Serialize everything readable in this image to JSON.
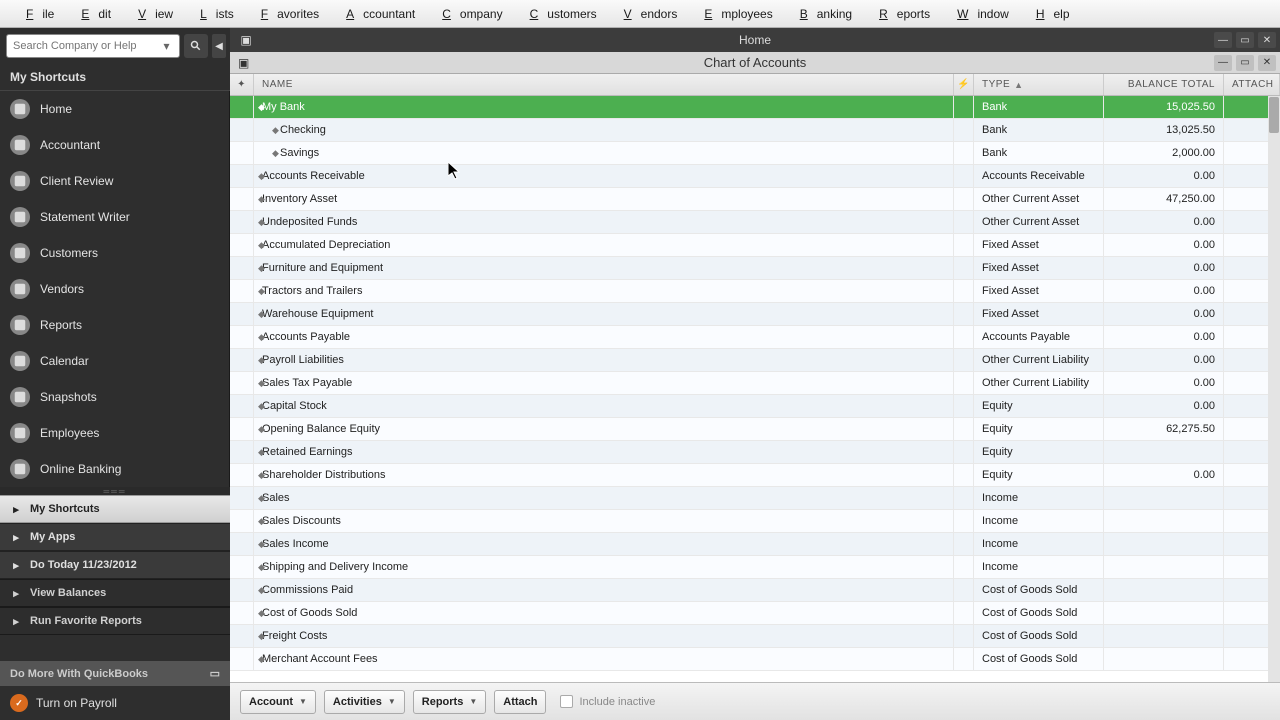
{
  "menubar": [
    "File",
    "Edit",
    "View",
    "Lists",
    "Favorites",
    "Accountant",
    "Company",
    "Customers",
    "Vendors",
    "Employees",
    "Banking",
    "Reports",
    "Window",
    "Help"
  ],
  "search": {
    "placeholder": "Search Company or Help"
  },
  "sidebar": {
    "shortcuts_header": "My Shortcuts",
    "items": [
      {
        "label": "Home",
        "icon": "home"
      },
      {
        "label": "Accountant",
        "icon": "accountant"
      },
      {
        "label": "Client Review",
        "icon": "clipboard"
      },
      {
        "label": "Statement Writer",
        "icon": "document"
      },
      {
        "label": "Customers",
        "icon": "people"
      },
      {
        "label": "Vendors",
        "icon": "truck"
      },
      {
        "label": "Reports",
        "icon": "report"
      },
      {
        "label": "Calendar",
        "icon": "calendar"
      },
      {
        "label": "Snapshots",
        "icon": "camera"
      },
      {
        "label": "Employees",
        "icon": "employees"
      },
      {
        "label": "Online Banking",
        "icon": "bank"
      }
    ],
    "tabs": [
      {
        "label": "My Shortcuts"
      },
      {
        "label": "My Apps"
      },
      {
        "label": "Do Today 11/23/2012"
      },
      {
        "label": "View Balances"
      },
      {
        "label": "Run Favorite Reports"
      }
    ],
    "do_more_header": "Do More With QuickBooks",
    "payroll_label": "Turn on Payroll"
  },
  "home_window": {
    "title": "Home"
  },
  "chart_window": {
    "title": "Chart of Accounts"
  },
  "columns": {
    "name": "NAME",
    "type": "TYPE",
    "balance": "BALANCE TOTAL",
    "attach": "ATTACH"
  },
  "accounts": [
    {
      "name": "My Bank",
      "type": "Bank",
      "balance": "15,025.50",
      "indent": 0,
      "selected": true
    },
    {
      "name": "Checking",
      "type": "Bank",
      "balance": "13,025.50",
      "indent": 1
    },
    {
      "name": "Savings",
      "type": "Bank",
      "balance": "2,000.00",
      "indent": 1
    },
    {
      "name": "Accounts Receivable",
      "type": "Accounts Receivable",
      "balance": "0.00",
      "indent": 0
    },
    {
      "name": "Inventory Asset",
      "type": "Other Current Asset",
      "balance": "47,250.00",
      "indent": 0
    },
    {
      "name": "Undeposited Funds",
      "type": "Other Current Asset",
      "balance": "0.00",
      "indent": 0
    },
    {
      "name": "Accumulated Depreciation",
      "type": "Fixed Asset",
      "balance": "0.00",
      "indent": 0
    },
    {
      "name": "Furniture and Equipment",
      "type": "Fixed Asset",
      "balance": "0.00",
      "indent": 0
    },
    {
      "name": "Tractors and Trailers",
      "type": "Fixed Asset",
      "balance": "0.00",
      "indent": 0
    },
    {
      "name": "Warehouse Equipment",
      "type": "Fixed Asset",
      "balance": "0.00",
      "indent": 0
    },
    {
      "name": "Accounts Payable",
      "type": "Accounts Payable",
      "balance": "0.00",
      "indent": 0
    },
    {
      "name": "Payroll Liabilities",
      "type": "Other Current Liability",
      "balance": "0.00",
      "indent": 0
    },
    {
      "name": "Sales Tax Payable",
      "type": "Other Current Liability",
      "balance": "0.00",
      "indent": 0
    },
    {
      "name": "Capital Stock",
      "type": "Equity",
      "balance": "0.00",
      "indent": 0
    },
    {
      "name": "Opening Balance Equity",
      "type": "Equity",
      "balance": "62,275.50",
      "indent": 0
    },
    {
      "name": "Retained Earnings",
      "type": "Equity",
      "balance": "",
      "indent": 0
    },
    {
      "name": "Shareholder Distributions",
      "type": "Equity",
      "balance": "0.00",
      "indent": 0
    },
    {
      "name": "Sales",
      "type": "Income",
      "balance": "",
      "indent": 0
    },
    {
      "name": "Sales Discounts",
      "type": "Income",
      "balance": "",
      "indent": 0
    },
    {
      "name": "Sales Income",
      "type": "Income",
      "balance": "",
      "indent": 0
    },
    {
      "name": "Shipping and Delivery Income",
      "type": "Income",
      "balance": "",
      "indent": 0
    },
    {
      "name": "Commissions Paid",
      "type": "Cost of Goods Sold",
      "balance": "",
      "indent": 0
    },
    {
      "name": "Cost of Goods Sold",
      "type": "Cost of Goods Sold",
      "balance": "",
      "indent": 0
    },
    {
      "name": "Freight Costs",
      "type": "Cost of Goods Sold",
      "balance": "",
      "indent": 0
    },
    {
      "name": "Merchant Account Fees",
      "type": "Cost of Goods Sold",
      "balance": "",
      "indent": 0
    }
  ],
  "bottom": {
    "account": "Account",
    "activities": "Activities",
    "reports": "Reports",
    "attach": "Attach",
    "include_inactive": "Include inactive"
  }
}
